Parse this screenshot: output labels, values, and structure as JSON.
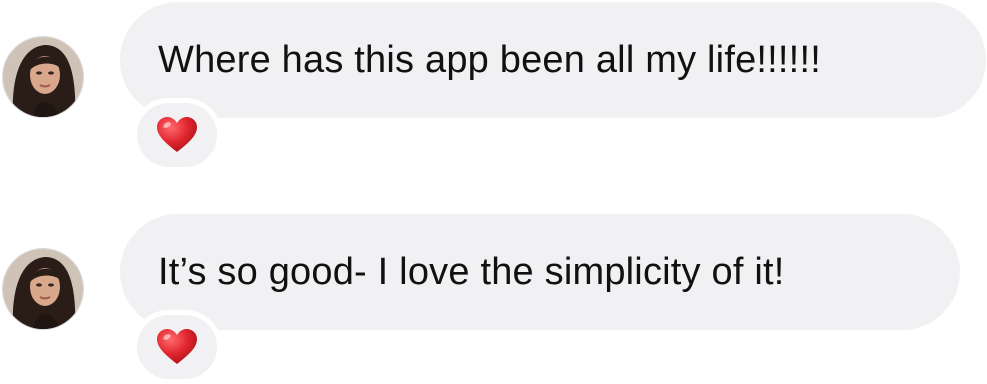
{
  "messages": [
    {
      "text": "Where has this app been all my life!!!!!!",
      "reaction": "heart-icon"
    },
    {
      "text": "It’s so good- I love the simplicity of it!",
      "reaction": "heart-icon"
    }
  ],
  "colors": {
    "bubble": "#f1f1f3",
    "text": "#111111",
    "heart": "#e0262f"
  }
}
